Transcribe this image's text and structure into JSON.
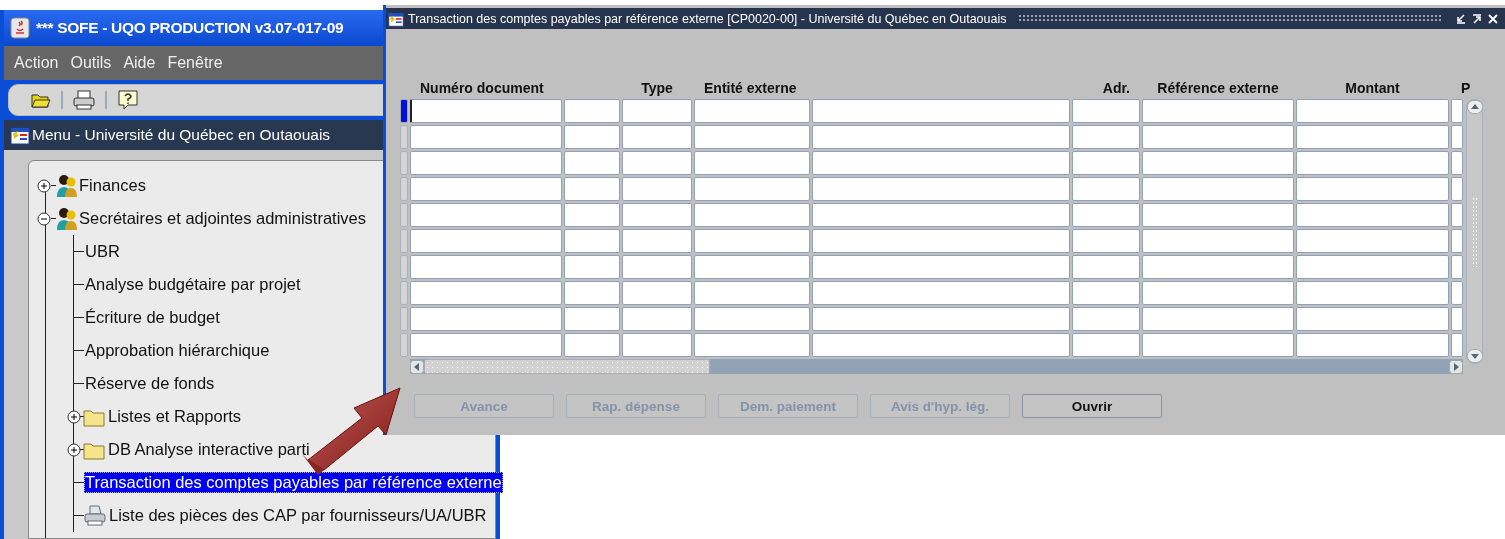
{
  "main_window": {
    "title": "*** SOFE - UQO PRODUCTION v3.07-017-09",
    "menu": [
      "Action",
      "Outils",
      "Aide",
      "Fenêtre"
    ]
  },
  "menu_window": {
    "title": "Menu - Université du Québec en Outaouais"
  },
  "tree": [
    {
      "label": "Finances",
      "kind": "group",
      "expanded": false,
      "selected": false
    },
    {
      "label": "Secrétaires et adjointes administratives",
      "kind": "group",
      "expanded": true,
      "selected": false,
      "children": [
        {
          "label": "UBR",
          "kind": "form",
          "selected": false
        },
        {
          "label": "Analyse budgétaire par projet",
          "kind": "form",
          "selected": false
        },
        {
          "label": "Écriture de budget",
          "kind": "form",
          "selected": false
        },
        {
          "label": "Approbation hiérarchique",
          "kind": "form",
          "selected": false
        },
        {
          "label": "Réserve de fonds",
          "kind": "form",
          "selected": false
        },
        {
          "label": "Listes et Rapports",
          "kind": "folder",
          "expanded": false,
          "selected": false
        },
        {
          "label": "DB Analyse interactive parti",
          "kind": "folder",
          "expanded": false,
          "selected": false
        },
        {
          "label": "Transaction des comptes payables par référence externe",
          "kind": "form",
          "selected": true
        },
        {
          "label": "Liste des pièces des CAP par fournisseurs/UA/UBR",
          "kind": "report",
          "selected": false
        }
      ]
    }
  ],
  "form_window": {
    "title": "Transaction des comptes payables par référence externe [CP0020-00] - Université du Québec en Outaouais",
    "table": {
      "columns": [
        {
          "label": "Numéro document"
        },
        {},
        {
          "label": "Type"
        },
        {
          "label": "Entité externe"
        },
        {},
        {
          "label": "Adr."
        },
        {
          "label": "Référence externe"
        },
        {
          "label": "Montant"
        },
        {
          "label": "P"
        }
      ],
      "rows": [
        {
          "selected": true
        },
        {
          "selected": false
        },
        {
          "selected": false
        },
        {
          "selected": false
        },
        {
          "selected": false
        },
        {
          "selected": false
        },
        {
          "selected": false
        },
        {
          "selected": false
        },
        {
          "selected": false
        },
        {
          "selected": false
        }
      ]
    },
    "buttons": [
      {
        "label": "Avance",
        "disabled": true
      },
      {
        "label": "Rap. dépense",
        "disabled": true
      },
      {
        "label": "Dem. paiement",
        "disabled": true
      },
      {
        "label": "Avis d'hyp. lég.",
        "disabled": true
      },
      {
        "label": "Ouvrir",
        "disabled": false
      }
    ]
  }
}
